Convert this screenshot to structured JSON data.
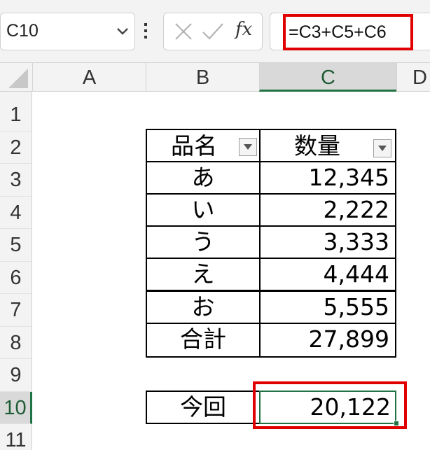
{
  "name_box": {
    "value": "C10"
  },
  "formula_bar": {
    "formula": "=C3+C5+C6",
    "fx_label": "fx"
  },
  "columns": [
    "A",
    "B",
    "C",
    "D"
  ],
  "rows": [
    "1",
    "2",
    "3",
    "4",
    "5",
    "6",
    "7",
    "8",
    "9",
    "10",
    "11"
  ],
  "table": {
    "header": {
      "name": "品名",
      "qty": "数量"
    },
    "items": [
      {
        "name": "あ",
        "qty": "12,345"
      },
      {
        "name": "い",
        "qty": "2,222"
      },
      {
        "name": "う",
        "qty": "3,333"
      },
      {
        "name": "え",
        "qty": "4,444"
      },
      {
        "name": "お",
        "qty": "5,555"
      }
    ],
    "total": {
      "name": "合計",
      "qty": "27,899"
    }
  },
  "summary": {
    "label": "今回",
    "value": "20,122"
  },
  "icons": {
    "name_box_dropdown": "chevron-down-icon",
    "more": "vertical-dots-icon",
    "cancel": "close-icon",
    "enter": "check-icon",
    "function": "fx-icon",
    "filter": "filter-dropdown-icon"
  },
  "colors": {
    "highlight": "#e00000",
    "selection": "#217346",
    "header_bg": "#f3f3f3",
    "selected_header_bg": "#d9d9d9"
  }
}
